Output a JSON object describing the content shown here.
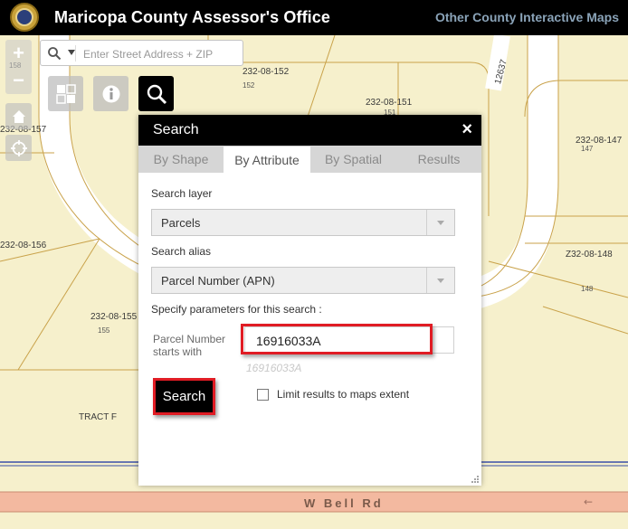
{
  "header": {
    "title": "Maricopa County Assessor's Office",
    "other_maps": "Other County Interactive Maps"
  },
  "map": {
    "address_search": {
      "placeholder": "Enter Street Address + ZIP"
    },
    "zoom": {
      "in": "+",
      "out": "−"
    },
    "parcels": [
      {
        "id": "232-08-152",
        "sub": "152"
      },
      {
        "id": "232-08-151",
        "sub": "151"
      },
      {
        "id": "232-08-147",
        "sub": "147"
      },
      {
        "id": "232-08-157",
        "sub": "158"
      },
      {
        "id": "232-08-156",
        "sub": ""
      },
      {
        "id": "232-08-155",
        "sub": "155"
      },
      {
        "id": "Z32-08-148",
        "sub": "148"
      }
    ],
    "tract_label": "TRACT F",
    "street_vertical": "12637",
    "road_label": "W Bell Rd"
  },
  "search_panel": {
    "title": "Search",
    "close": "×",
    "tabs": [
      {
        "label": "By Shape",
        "active": false
      },
      {
        "label": "By Attribute",
        "active": true
      },
      {
        "label": "By Spatial",
        "active": false
      },
      {
        "label": "Results",
        "active": false
      }
    ],
    "search_layer_label": "Search layer",
    "search_layer_value": "Parcels",
    "search_alias_label": "Search alias",
    "search_alias_value": "Parcel Number (APN)",
    "params_label": "Specify parameters for this search :",
    "param_field_label": "Parcel Number starts with",
    "param_value": "16916033A",
    "param_hint": "16916033A",
    "search_button": "Search",
    "limit_label": "Limit results to maps extent"
  },
  "colors": {
    "header_bg": "#000000",
    "map_bg": "#f6f0cc",
    "highlight": "#e01c24",
    "road": "#f3b9a0"
  }
}
